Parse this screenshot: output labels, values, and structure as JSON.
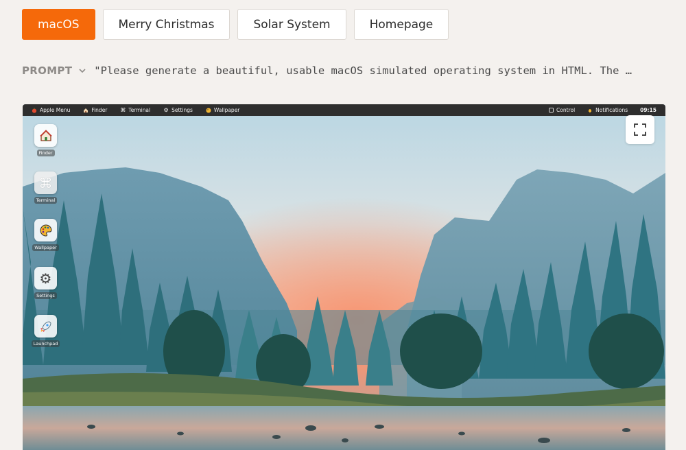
{
  "tabs": [
    {
      "label": "macOS",
      "active": true
    },
    {
      "label": "Merry Christmas",
      "active": false
    },
    {
      "label": "Solar System",
      "active": false
    },
    {
      "label": "Homepage",
      "active": false
    }
  ],
  "prompt": {
    "label": "PROMPT",
    "text": "\"Please generate a beautiful, usable macOS simulated operating system in HTML. The …"
  },
  "menubar": {
    "left": [
      {
        "label": "Apple Menu",
        "icon": "apple-icon"
      },
      {
        "label": "Finder",
        "icon": "home-icon"
      },
      {
        "label": "Terminal",
        "icon": "command-icon"
      },
      {
        "label": "Settings",
        "icon": "gear-icon"
      },
      {
        "label": "Wallpaper",
        "icon": "palette-icon"
      }
    ],
    "control": "Control",
    "notifications": "Notifications",
    "time": "09:15"
  },
  "desktop_icons": [
    {
      "label": "Finder",
      "icon": "house-icon"
    },
    {
      "label": "Terminal",
      "icon": "command-icon"
    },
    {
      "label": "Wallpaper",
      "icon": "palette-icon"
    },
    {
      "label": "Settings",
      "icon": "gear-icon"
    },
    {
      "label": "Launchpad",
      "icon": "rocket-icon"
    }
  ],
  "colors": {
    "accent": "#f5690a",
    "page_bg": "#f4f1ee",
    "menubar_bg": "#2e2e2e"
  }
}
